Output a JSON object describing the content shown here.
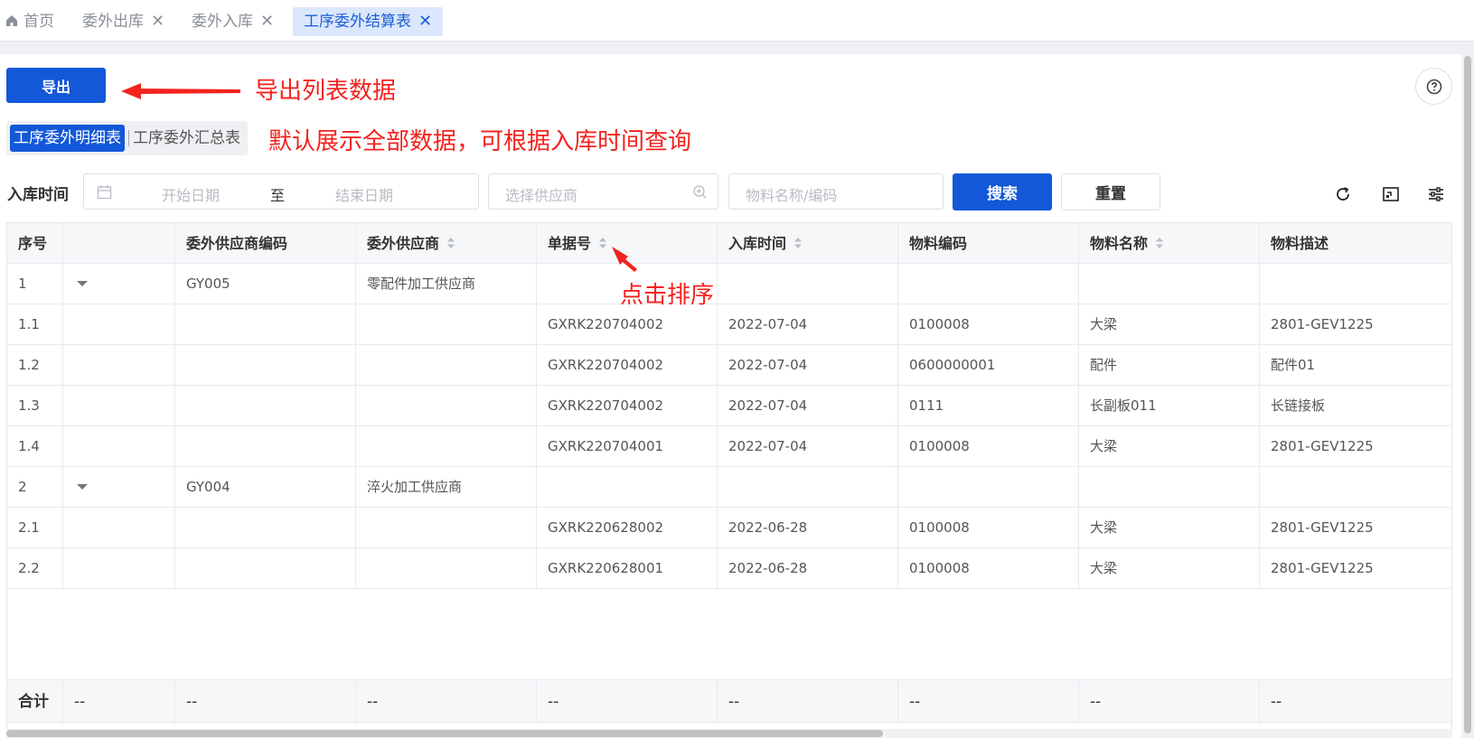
{
  "tabs": [
    {
      "label": "首页",
      "closable": false,
      "active": false
    },
    {
      "label": "委外出库",
      "closable": true,
      "active": false
    },
    {
      "label": "委外入库",
      "closable": true,
      "active": false
    },
    {
      "label": "工序委外结算表",
      "closable": true,
      "active": true
    }
  ],
  "toolbar": {
    "export_label": "导出",
    "help_icon": "question-circle-icon"
  },
  "annotations": {
    "export_note": "导出列表数据",
    "default_note": "默认展示全部数据，可根据入库时间查询",
    "sort_note": "点击排序"
  },
  "segmented": {
    "options": [
      "工序委外明细表",
      "工序委外汇总表"
    ],
    "selected": "工序委外明细表"
  },
  "filters": {
    "date_label": "入库时间",
    "start_placeholder": "开始日期",
    "separator": "至",
    "end_placeholder": "结束日期",
    "supplier_placeholder": "选择供应商",
    "material_placeholder": "物料名称/编码",
    "search_label": "搜索",
    "reset_label": "重置"
  },
  "table": {
    "columns": [
      "序号",
      "",
      "委外供应商编码",
      "委外供应商",
      "单据号",
      "入库时间",
      "物料编码",
      "物料名称",
      "物料描述"
    ],
    "sortable": [
      false,
      false,
      false,
      true,
      true,
      true,
      false,
      true,
      false
    ],
    "rows": [
      {
        "seq": "1",
        "expand": true,
        "supplier_code": "GY005",
        "supplier": "零配件加工供应商",
        "doc_no": "",
        "date": "",
        "material_code": "",
        "material_name": "",
        "desc": ""
      },
      {
        "seq": "1.1",
        "expand": false,
        "supplier_code": "",
        "supplier": "",
        "doc_no": "GXRK220704002",
        "date": "2022-07-04",
        "material_code": "0100008",
        "material_name": "大梁",
        "desc": "2801-GEV1225"
      },
      {
        "seq": "1.2",
        "expand": false,
        "supplier_code": "",
        "supplier": "",
        "doc_no": "GXRK220704002",
        "date": "2022-07-04",
        "material_code": "0600000001",
        "material_name": "配件",
        "desc": "配件01"
      },
      {
        "seq": "1.3",
        "expand": false,
        "supplier_code": "",
        "supplier": "",
        "doc_no": "GXRK220704002",
        "date": "2022-07-04",
        "material_code": "0111",
        "material_name": "长副板011",
        "desc": "长链接板"
      },
      {
        "seq": "1.4",
        "expand": false,
        "supplier_code": "",
        "supplier": "",
        "doc_no": "GXRK220704001",
        "date": "2022-07-04",
        "material_code": "0100008",
        "material_name": "大梁",
        "desc": "2801-GEV1225"
      },
      {
        "seq": "2",
        "expand": true,
        "supplier_code": "GY004",
        "supplier": "淬火加工供应商",
        "doc_no": "",
        "date": "",
        "material_code": "",
        "material_name": "",
        "desc": ""
      },
      {
        "seq": "2.1",
        "expand": false,
        "supplier_code": "",
        "supplier": "",
        "doc_no": "GXRK220628002",
        "date": "2022-06-28",
        "material_code": "0100008",
        "material_name": "大梁",
        "desc": "2801-GEV1225"
      },
      {
        "seq": "2.2",
        "expand": false,
        "supplier_code": "",
        "supplier": "",
        "doc_no": "GXRK220628001",
        "date": "2022-06-28",
        "material_code": "0100008",
        "material_name": "大梁",
        "desc": "2801-GEV1225"
      }
    ],
    "total_label": "合计",
    "total_values": [
      "--",
      "--",
      "--",
      "--",
      "--",
      "--",
      "--",
      "--"
    ]
  },
  "colors": {
    "primary": "#1358d8",
    "annotation": "#f2231f"
  }
}
